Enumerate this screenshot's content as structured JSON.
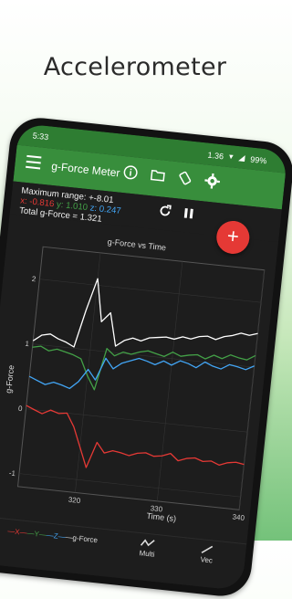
{
  "headline": "Accelerometer",
  "status": {
    "time": "5:33",
    "battery": "99%",
    "network": "1.36"
  },
  "appbar": {
    "title": "g-Force Meter",
    "icons": [
      "info-icon",
      "folder-icon",
      "rotate-icon",
      "gear-icon"
    ]
  },
  "readout": {
    "max_range": "Maximum range: +-8.01",
    "x": "x: -0.816",
    "y": "y: 1.010",
    "z": "z: 0.247",
    "total": "Total g-Force = 1.321"
  },
  "fab_label": "+",
  "chart_data": {
    "type": "line",
    "title": "g-Force vs Time",
    "xlabel": "Time (s)",
    "ylabel": "g-Force",
    "xlim": [
      313,
      340
    ],
    "ylim": [
      -1.2,
      2.5
    ],
    "xticks": [
      "320",
      "330",
      "340"
    ],
    "yticks": [
      "2",
      "1",
      "0",
      "-1"
    ],
    "series": [
      {
        "name": "Total",
        "color": "#ffffff",
        "x": [
          313,
          314,
          315,
          316,
          317,
          318,
          319,
          320,
          321,
          322,
          323,
          324,
          325,
          326,
          327,
          328,
          329,
          330,
          331,
          332,
          333,
          334,
          335,
          336,
          337,
          338,
          339,
          340
        ],
        "values": [
          1.05,
          1.15,
          1.18,
          1.12,
          1.08,
          1.02,
          1.6,
          2.1,
          1.45,
          1.6,
          1.1,
          1.2,
          1.25,
          1.22,
          1.28,
          1.3,
          1.32,
          1.3,
          1.35,
          1.33,
          1.38,
          1.4,
          1.36,
          1.42,
          1.45,
          1.5,
          1.48,
          1.52
        ]
      },
      {
        "name": "y",
        "color": "#43a047",
        "x": [
          313,
          314,
          315,
          316,
          317,
          318,
          319,
          320,
          321,
          322,
          323,
          324,
          325,
          326,
          327,
          328,
          329,
          330,
          331,
          332,
          333,
          334,
          335,
          336,
          337,
          338,
          339,
          340
        ],
        "values": [
          0.95,
          0.98,
          0.92,
          0.96,
          0.93,
          0.9,
          0.85,
          0.6,
          0.4,
          1.05,
          0.95,
          1.02,
          1.0,
          1.05,
          1.08,
          1.05,
          1.02,
          1.1,
          1.05,
          1.08,
          1.1,
          1.05,
          1.12,
          1.08,
          1.15,
          1.12,
          1.1,
          1.18
        ]
      },
      {
        "name": "z",
        "color": "#42a5f5",
        "x": [
          313,
          314,
          315,
          316,
          317,
          318,
          319,
          320,
          321,
          322,
          323,
          324,
          325,
          326,
          327,
          328,
          329,
          330,
          331,
          332,
          333,
          334,
          335,
          336,
          337,
          338,
          339,
          340
        ],
        "values": [
          0.5,
          0.45,
          0.4,
          0.45,
          0.42,
          0.38,
          0.5,
          0.7,
          0.55,
          0.9,
          0.75,
          0.85,
          0.9,
          0.95,
          0.92,
          0.88,
          0.95,
          0.9,
          0.98,
          0.95,
          0.9,
          1.0,
          0.95,
          0.92,
          1.0,
          0.98,
          0.95,
          1.02
        ]
      },
      {
        "name": "x",
        "color": "#e53935",
        "x": [
          313,
          314,
          315,
          316,
          317,
          318,
          319,
          320,
          321,
          322,
          323,
          324,
          325,
          326,
          327,
          328,
          329,
          330,
          331,
          332,
          333,
          334,
          335,
          336,
          337,
          338,
          339,
          340
        ],
        "values": [
          0.05,
          0.0,
          -0.05,
          0.02,
          -0.02,
          0.0,
          -0.2,
          -0.5,
          -0.8,
          -0.4,
          -0.55,
          -0.5,
          -0.52,
          -0.55,
          -0.5,
          -0.48,
          -0.52,
          -0.5,
          -0.45,
          -0.55,
          -0.5,
          -0.48,
          -0.52,
          -0.5,
          -0.55,
          -0.5,
          -0.48,
          -0.5
        ]
      }
    ]
  },
  "bottomnav": {
    "legend_x": "—X—",
    "legend_y": "—Y—",
    "legend_z": "—Z—",
    "legend_g": "—g-Force",
    "items": [
      {
        "label": "Multi"
      },
      {
        "label": "Vec"
      }
    ]
  }
}
